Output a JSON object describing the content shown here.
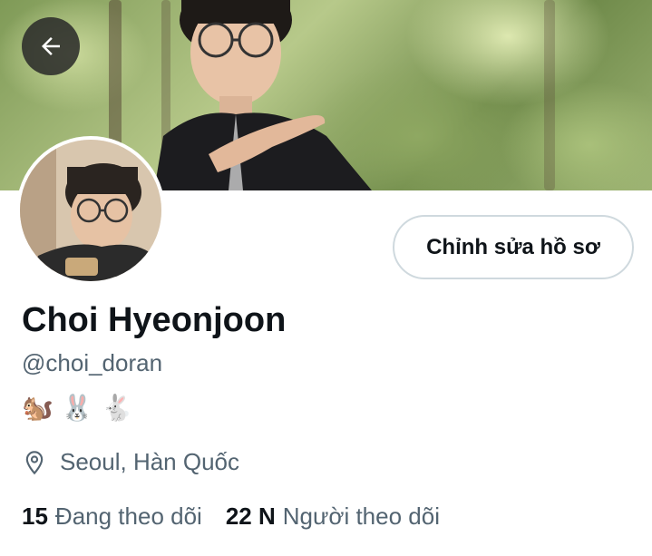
{
  "header": {
    "back_icon": "arrow-left-icon"
  },
  "profile": {
    "edit_button_label": "Chỉnh sửa hồ sơ",
    "display_name": "Choi Hyeonjoon",
    "handle": "@choi_doran",
    "bio_emojis": "🐿️ 🐰 🐇",
    "location_icon": "location-pin-icon",
    "location": "Seoul, Hàn Quốc"
  },
  "stats": {
    "following_count": "15",
    "following_label": "Đang theo dõi",
    "followers_count": "22 N",
    "followers_label": "Người theo dõi"
  },
  "colors": {
    "text_primary": "#0f1419",
    "text_secondary": "#536471",
    "button_border": "#cfd9de"
  }
}
